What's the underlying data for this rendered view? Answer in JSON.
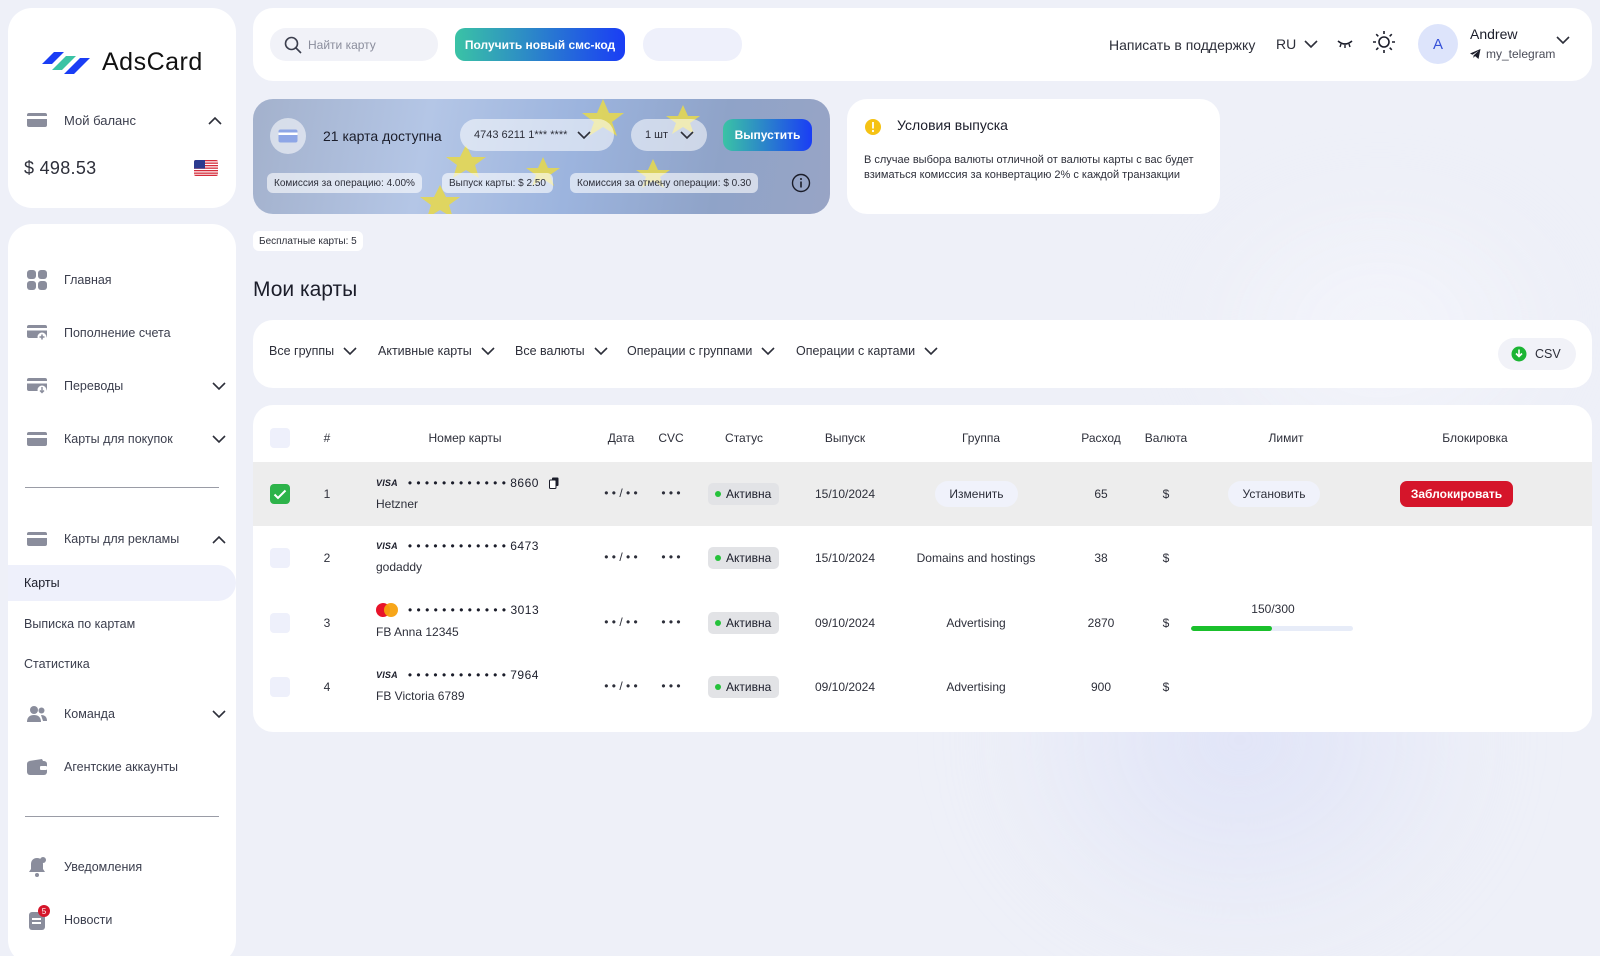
{
  "brand": {
    "name": "AdsCard"
  },
  "balance": {
    "label": "Мой баланс",
    "amount": "$ 498.53"
  },
  "nav": {
    "home": "Главная",
    "topup": "Пополнение счета",
    "transfers": "Переводы",
    "shopping_cards": "Карты для покупок",
    "ad_cards": "Карты для рекламы",
    "sub_cards": "Карты",
    "sub_statement": "Выписка по картам",
    "sub_stats": "Статистика",
    "team": "Команда",
    "agency": "Агентские аккаунты",
    "notifications": "Уведомления",
    "news": "Новости",
    "news_badge": "5"
  },
  "topbar": {
    "search_placeholder": "Найти карту",
    "sms_button": "Получить новый смс-код",
    "support": "Написать в поддержку",
    "lang": "RU",
    "user_initial": "A",
    "user_name": "Andrew",
    "user_telegram": "my_telegram"
  },
  "issue": {
    "available": "21 карта доступна",
    "card_select": "4743 6211 1*** ****",
    "qty": "1 шт",
    "button": "Выпустить",
    "fee_op": "Комиссия за операцию: 4.00%",
    "fee_issue": "Выпуск карты: $ 2.50",
    "fee_cancel": "Комиссия за отмену операции: $ 0.30"
  },
  "conditions": {
    "title": "Условия выпуска",
    "text": "В случае выбора валюты отличной от валюты карты с вас будет взиматься комиссия за конвертацию 2% с каждой транзакции"
  },
  "free_cards": "Бесплатные карты: 5",
  "section_title": "Мои карты",
  "filters": {
    "groups": "Все группы",
    "active": "Активные карты",
    "currencies": "Все валюты",
    "group_ops": "Операции с группами",
    "card_ops": "Операции с картами",
    "csv": "CSV"
  },
  "table": {
    "headers": {
      "num": "#",
      "card": "Номер карты",
      "date": "Дата",
      "cvc": "CVC",
      "status": "Статус",
      "issued": "Выпуск",
      "group": "Группа",
      "spend": "Расход",
      "currency": "Валюта",
      "limit": "Лимит",
      "block": "Блокировка"
    },
    "rows": [
      {
        "n": "1",
        "brand": "VISA",
        "mask": "• • • •  • • • •  • • • •",
        "last4": "8660",
        "name": "Hetzner",
        "date": "• • / • •",
        "cvc": "• • •",
        "status": "Активна",
        "issued": "15/10/2024",
        "group": "Изменить",
        "spend": "65",
        "currency": "$",
        "limit": "Установить",
        "block": "Заблокировать"
      },
      {
        "n": "2",
        "brand": "VISA",
        "mask": "• • • •  • • • •  • • • •",
        "last4": "6473",
        "name": "godaddy",
        "date": "• • / • •",
        "cvc": "• • •",
        "status": "Активна",
        "issued": "15/10/2024",
        "group": "Domains and hostings",
        "spend": "38",
        "currency": "$"
      },
      {
        "n": "3",
        "brand": "Mastercard",
        "mask": "• • • •  • • • •  • • • •",
        "last4": "3013",
        "name": "FB Anna 12345",
        "date": "• • / • •",
        "cvc": "• • •",
        "status": "Активна",
        "issued": "09/10/2024",
        "group": "Advertising",
        "spend": "2870",
        "currency": "$",
        "limit": "150/300",
        "limit_fraction": 0.5
      },
      {
        "n": "4",
        "brand": "VISA",
        "mask": "• • • •  • • • •  • • • •",
        "last4": "7964",
        "name": "FB Victoria 6789",
        "date": "• • / • •",
        "cvc": "• • •",
        "status": "Активна",
        "issued": "09/10/2024",
        "group": "Advertising",
        "spend": "900",
        "currency": "$"
      }
    ]
  },
  "colors": {
    "accent_gradient_start": "#3ac3a5",
    "accent_gradient_end": "#1a3df5",
    "block_red": "#d5152a",
    "active_green": "#25c23b",
    "checked_green": "#2db34a"
  }
}
